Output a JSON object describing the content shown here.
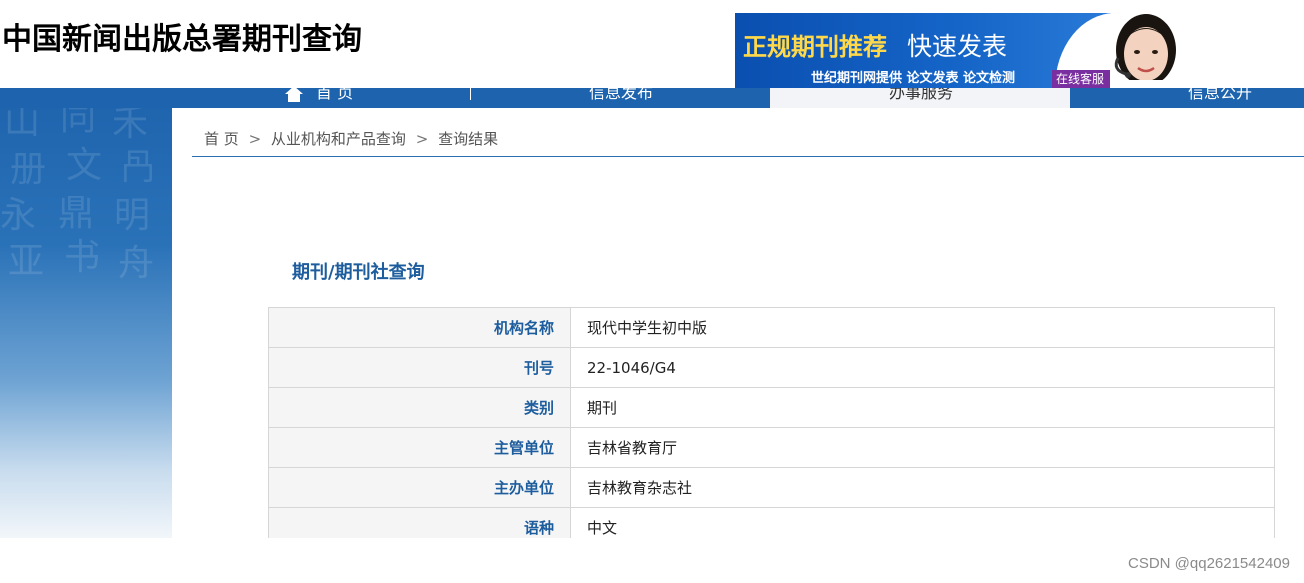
{
  "header": {
    "site_title": "中国新闻出版总署期刊查询"
  },
  "ad": {
    "headline": "正规期刊推荐",
    "headline_2": "快速发表",
    "subline": "世纪期刊网提供  论文发表  论文检测",
    "chat_label": "在线客服"
  },
  "nav": {
    "home": "首 页",
    "info_release": "信息发布",
    "service": "办事服务",
    "info_public": "信息公开"
  },
  "breadcrumb": {
    "home": "首 页",
    "category": "从业机构和产品查询",
    "current": "查询结果",
    "separator": ">"
  },
  "section": {
    "title": "期刊/期刊社查询"
  },
  "result_rows": [
    {
      "label": "机构名称",
      "value": "现代中学生初中版"
    },
    {
      "label": "刊号",
      "value": "22-1046/G4"
    },
    {
      "label": "类别",
      "value": "期刊"
    },
    {
      "label": "主管单位",
      "value": "吉林省教育厅"
    },
    {
      "label": "主办单位",
      "value": "吉林教育杂志社"
    },
    {
      "label": "语种",
      "value": "中文"
    }
  ],
  "watermark": "CSDN @qq2621542409",
  "colors": {
    "nav_blue": "#1d63ad",
    "label_blue": "#1d5d9e",
    "ad_yellow": "#ffd94a"
  }
}
